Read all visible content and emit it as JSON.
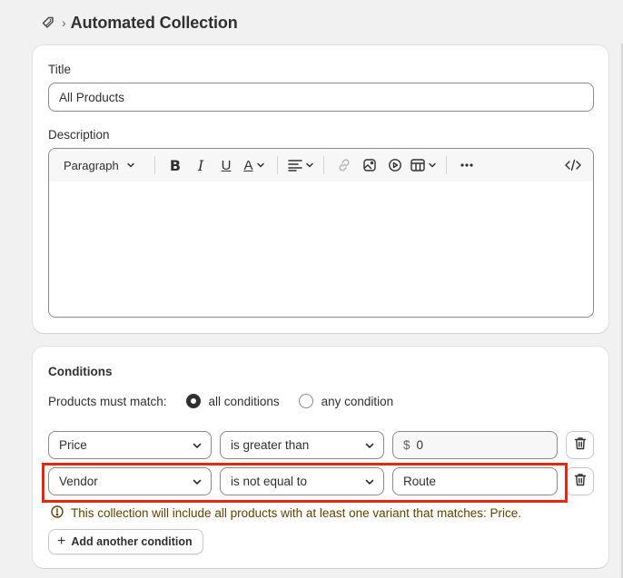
{
  "header": {
    "icon": "collection-tag-icon",
    "separator": "›",
    "title": "Automated Collection"
  },
  "form": {
    "title_label": "Title",
    "title_value": "All Products",
    "description_label": "Description",
    "editor": {
      "format_select": "Paragraph",
      "tools": [
        "bold-icon",
        "italic-icon",
        "underline-icon",
        "text-color-icon",
        "align-icon",
        "link-icon",
        "image-icon",
        "video-icon",
        "table-icon",
        "more-icon",
        "code-icon"
      ],
      "content": ""
    }
  },
  "conditions": {
    "heading": "Conditions",
    "match_label": "Products must match:",
    "options": [
      "all conditions",
      "any condition"
    ],
    "selected_option": "all conditions",
    "rows": [
      {
        "field": "Price",
        "operator": "is greater than",
        "prefix": "$",
        "value": "0"
      },
      {
        "field": "Vendor",
        "operator": "is not equal to",
        "prefix": "",
        "value": "Route"
      }
    ],
    "warning": "This collection will include all products with at least one variant that matches: Price.",
    "add_button": "Add another condition"
  },
  "colors": {
    "highlight": "#e8260c",
    "warning_text": "#5e4200",
    "background": "#f1f1f1"
  }
}
